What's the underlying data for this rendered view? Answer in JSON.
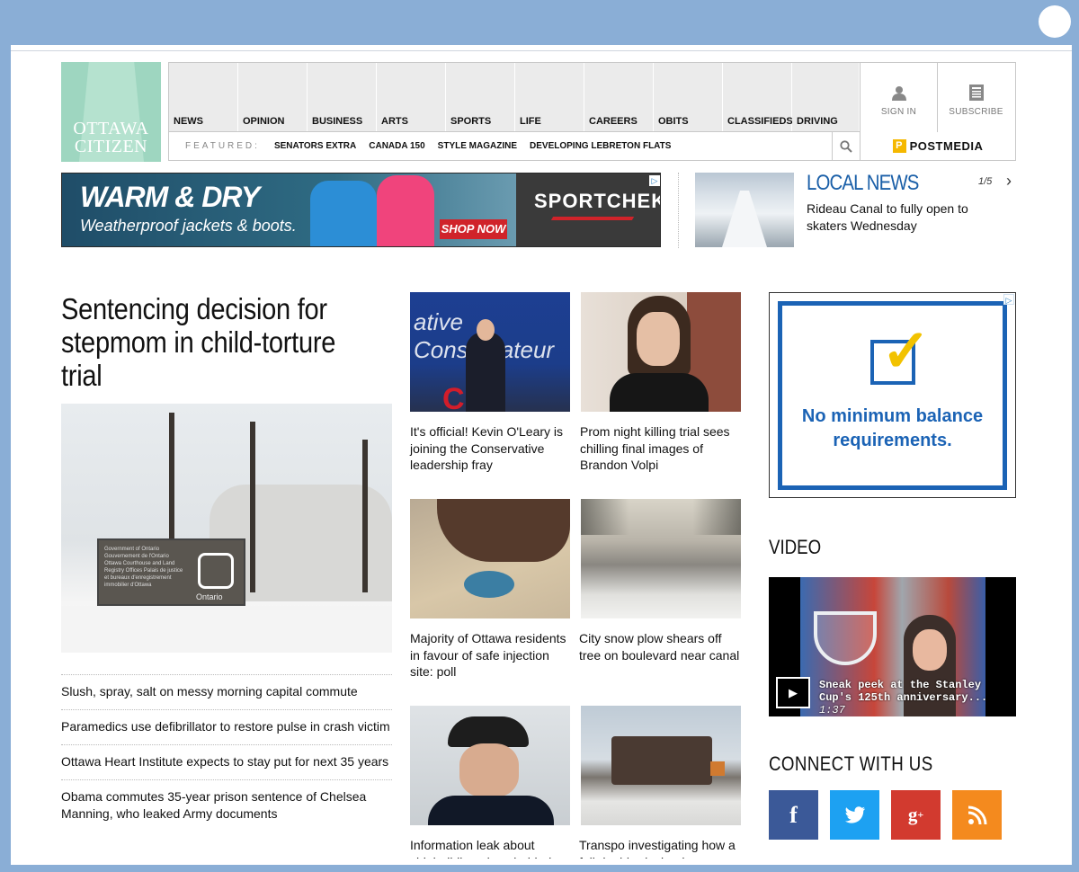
{
  "logo": {
    "line1": "OTTAWA",
    "line2": "CITIZEN"
  },
  "nav": {
    "sections": [
      "NEWS",
      "OPINION",
      "BUSINESS",
      "ARTS",
      "SPORTS",
      "LIFE",
      "CAREERS",
      "OBITS",
      "CLASSIFIEDS",
      "DRIVING"
    ],
    "featured_label": "FEATURED:",
    "featured": [
      "SENATORS EXTRA",
      "CANADA 150",
      "STYLE MAGAZINE",
      "DEVELOPING LEBRETON FLATS"
    ],
    "sign_in": "SIGN IN",
    "subscribe": "SUBSCRIBE",
    "postmedia": "POSTMEDIA"
  },
  "ad_banner": {
    "headline": "WARM & DRY",
    "subline": "Weatherproof jackets & boots.",
    "cta": "SHOP NOW",
    "brand": "SPORTCHEK"
  },
  "local_news": {
    "title": "LOCAL NEWS",
    "counter": "1/5",
    "headline": "Rideau Canal to fully open to skaters Wednesday"
  },
  "main_story": {
    "headline": "Sentencing decision for stepmom in child-torture trial",
    "image_sign_text": "Government of Ontario Gouvernement de l'Ontario Ottawa Courthouse and Land Registry Offices Palais de justice et bureaux d'enregistrement immobilier d'Ottawa",
    "image_sign_label": "Ontario"
  },
  "story_list": [
    "Slush, spray, salt on messy morning capital commute",
    "Paramedics use defibrillator to restore pulse in crash victim",
    "Ottawa Heart Institute expects to stay put for next 35 years",
    "Obama commutes 35-year prison sentence of Chelsea Manning, who leaked Army documents"
  ],
  "grid_stories": [
    {
      "headline": "It's official! Kevin O'Leary is joining the Conservative leadership fray",
      "image_text": "ative Conservateur"
    },
    {
      "headline": "Prom night killing trial sees chilling final images of Brandon Volpi"
    },
    {
      "headline": "Majority of Ottawa residents in favour of safe injection site: poll"
    },
    {
      "headline": "City snow plow shears off tree on boulevard near canal"
    },
    {
      "headline": "Information leak about shipbuilding plans behind"
    },
    {
      "headline": "Transpo investigating how a full double-decker bus"
    }
  ],
  "right_ad": {
    "message": "No minimum balance requirements."
  },
  "video": {
    "title": "VIDEO",
    "caption": "Sneak peek at the Stanley Cup's 125th anniversary...",
    "duration": "1:37"
  },
  "connect": {
    "title": "CONNECT WITH US"
  },
  "icons": {
    "user": "user-icon",
    "newspaper": "newspaper-icon",
    "search": "search-icon",
    "facebook": "facebook-icon",
    "twitter": "twitter-icon",
    "googleplus": "google-plus-icon",
    "rss": "rss-icon"
  },
  "colors": {
    "accent": "#1a5fa8",
    "page_bg": "#8aaed6",
    "facebook": "#3b5998",
    "twitter": "#1da1f2",
    "googleplus": "#d23a2f",
    "rss": "#f48a1e"
  }
}
